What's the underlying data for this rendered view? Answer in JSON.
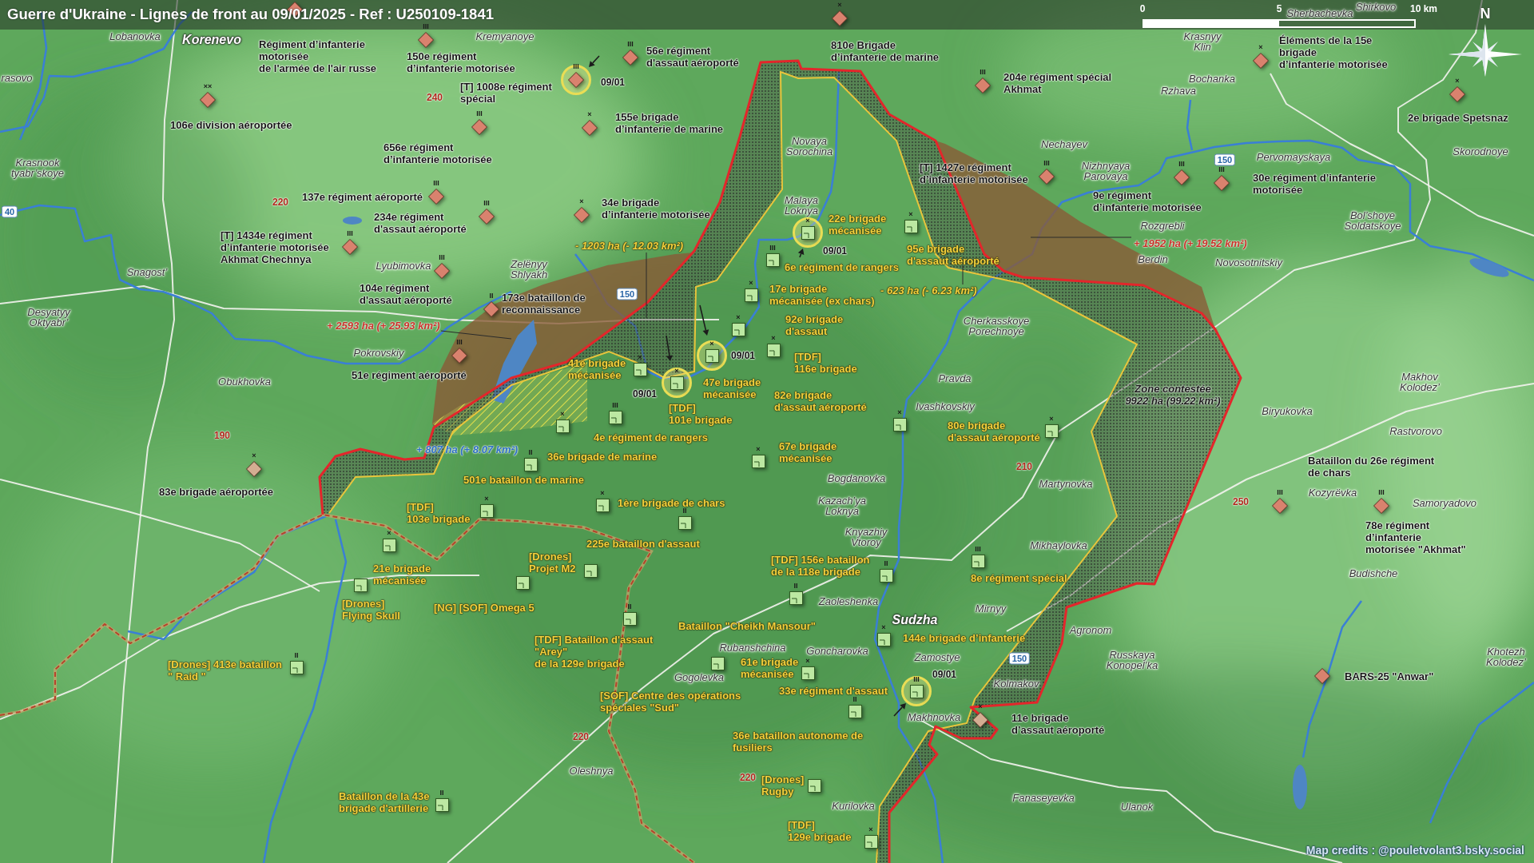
{
  "title": "Guerre d'Ukraine - Lignes de front au 09/01/2025 - Ref : U250109-1841",
  "scale_bar": {
    "labels": [
      "0",
      "5",
      "10 km"
    ]
  },
  "compass": {
    "label": "N"
  },
  "units": [
    {
      "kind": "russian",
      "color": "#d9826e",
      "label": [
        "Régiment d’infanterie",
        "motorisée",
        "de l'armée de l'air russe"
      ]
    },
    {
      "kind": "russian",
      "echelon": "III",
      "color": "#d9826e",
      "label": [
        "150e régiment",
        "d’infanterie motorisée"
      ]
    },
    {
      "kind": "russian",
      "echelon": "III",
      "color": "#d9826e",
      "label": [
        "56e régiment",
        "d'assaut aéroporté"
      ]
    },
    {
      "kind": "russian",
      "echelon": "×",
      "color": "#d9826e",
      "label": [
        "810e Brigade",
        "d’infanterie de marine"
      ]
    },
    {
      "kind": "russian",
      "echelon": "×",
      "color": "#d9826e",
      "label": [
        "Éléments de la 15e",
        "brigade",
        "d’infanterie motorisée"
      ]
    },
    {
      "kind": "russian",
      "echelon": "III",
      "color": "#d9826e",
      "label": [
        "[T] 1008e régiment",
        "spécial"
      ],
      "date": "09/01"
    },
    {
      "kind": "russian",
      "echelon": "III",
      "color": "#d9826e",
      "label": [
        "204e régiment spécial",
        "Akhmat"
      ]
    },
    {
      "kind": "russian",
      "echelon": "××",
      "color": "#d9826e",
      "label": [
        "106e division aéroportée"
      ]
    },
    {
      "kind": "russian",
      "echelon": "×",
      "color": "#d9826e",
      "label": [
        "155e brigade",
        "d’infanterie de marine"
      ]
    },
    {
      "kind": "russian",
      "echelon": "×",
      "color": "#d9826e",
      "label": [
        "2e brigade Spetsnaz"
      ]
    },
    {
      "kind": "russian",
      "echelon": "III",
      "color": "#d9826e",
      "label": [
        "656e régiment",
        "d’infanterie motorisée"
      ]
    },
    {
      "kind": "russian",
      "echelon": "III",
      "color": "#d9826e",
      "label": [
        "[T] 1427e régiment",
        "d’infanterie motorisée"
      ]
    },
    {
      "kind": "russian",
      "echelon": "III",
      "color": "#d9826e",
      "label": [
        "137e régiment aéroporté"
      ]
    },
    {
      "kind": "russian",
      "echelon": "III",
      "color": "#d9826e",
      "label": [
        "9e régiment",
        "d’infanterie motorisée"
      ]
    },
    {
      "kind": "russian",
      "echelon": "III",
      "color": "#d9826e",
      "label": [
        "30e régiment d’infanterie",
        "motorisée"
      ]
    },
    {
      "kind": "russian",
      "echelon": "III",
      "color": "#d9826e",
      "label": [
        "234e régiment",
        "d'assaut aéroporté"
      ]
    },
    {
      "kind": "russian",
      "echelon": "×",
      "color": "#d9826e",
      "label": [
        "34e brigade",
        "d’infanterie motorisée"
      ]
    },
    {
      "kind": "russian",
      "echelon": "III",
      "color": "#d9826e",
      "label": [
        "[T] 1434e régiment",
        "d’infanterie motorisée",
        "Akhmat Chechnya"
      ]
    },
    {
      "kind": "ukrainian",
      "echelon": "×",
      "label": [
        "22e brigade",
        "mécanisée"
      ],
      "date": "09/01"
    },
    {
      "kind": "ukrainian",
      "echelon": "III",
      "label": [
        "6e régiment de rangers"
      ]
    },
    {
      "kind": "ukrainian",
      "echelon": "×",
      "label": [
        "95e brigade",
        "d'assaut aéroporté"
      ]
    },
    {
      "kind": "russian",
      "echelon": "III",
      "color": "#d9826e",
      "label": [
        "104e régiment",
        "d'assaut aéroporté"
      ]
    },
    {
      "kind": "russian",
      "echelon": "II",
      "color": "#d9826e",
      "label": [
        "173e bataillon de",
        "reconnaissance"
      ]
    },
    {
      "kind": "ukrainian",
      "echelon": "×",
      "label": [
        "17e brigade",
        "mécanisée (ex chars)"
      ]
    },
    {
      "kind": "ukrainian",
      "echelon": "×",
      "label": [
        "92e brigade",
        "d'assaut"
      ]
    },
    {
      "kind": "russian",
      "echelon": "III",
      "color": "#d9826e",
      "label": [
        "51e régiment aéroporté"
      ]
    },
    {
      "kind": "ukrainian",
      "echelon": "×",
      "label": [
        "41e brigade",
        "mécanisée"
      ]
    },
    {
      "kind": "ukrainian",
      "echelon": "×",
      "label": [
        "47e brigade",
        "mécanisée"
      ],
      "date": "09/01"
    },
    {
      "kind": "ukrainian",
      "echelon": "×",
      "label": [
        "[TDF]",
        "116e brigade"
      ]
    },
    {
      "kind": "ukrainian",
      "echelon": "×",
      "label": [
        "36e brigade de marine"
      ]
    },
    {
      "kind": "ukrainian",
      "echelon": "III",
      "label": [
        "4e régiment de rangers"
      ]
    },
    {
      "kind": "ukrainian",
      "echelon": "×",
      "label": [
        "[TDF]",
        "101e brigade"
      ],
      "date": "09/01"
    },
    {
      "kind": "ukrainian",
      "echelon": "×",
      "label": [
        "82e brigade",
        "d'assaut aéroporté"
      ]
    },
    {
      "kind": "ukrainian",
      "echelon": "×",
      "label": [
        "80e brigade",
        "d'assaut aéroporté"
      ]
    },
    {
      "kind": "russian",
      "echelon": "×",
      "color": "#d4ad92",
      "label": [
        "83e brigade aéroportée"
      ]
    },
    {
      "kind": "ukrainian",
      "echelon": "II",
      "label": [
        "501e bataillon de marine"
      ]
    },
    {
      "kind": "ukrainian",
      "echelon": "×",
      "label": [
        "67e brigade",
        "mécanisée"
      ]
    },
    {
      "kind": "ukrainian",
      "echelon": "×",
      "label": [
        "[TDF]",
        "103e brigade"
      ]
    },
    {
      "kind": "ukrainian",
      "echelon": "×",
      "label": [
        "1ère brigade de chars"
      ]
    },
    {
      "kind": "russian",
      "echelon": "III",
      "color": "#d9826e",
      "label": [
        "Bataillon du 26e régiment",
        "de chars"
      ]
    },
    {
      "kind": "ukrainian",
      "echelon": "II",
      "label": [
        "225e bataillon d'assaut"
      ]
    },
    {
      "kind": "russian",
      "echelon": "III",
      "color": "#d9826e",
      "label": [
        "78e régiment",
        "d’infanterie",
        "motorisée \"Akhmat\""
      ]
    },
    {
      "kind": "ukrainian",
      "echelon": "×",
      "label": [
        "21e brigade",
        "mécanisée"
      ]
    },
    {
      "kind": "ukrainian",
      "label": [
        "[Drones]",
        "Projet M2"
      ]
    },
    {
      "kind": "ukrainian",
      "echelon": "II",
      "label": [
        "[TDF] 156e bataillon",
        "de la 118e brigade"
      ]
    },
    {
      "kind": "ukrainian",
      "echelon": "III",
      "label": [
        "8e régiment spécial"
      ]
    },
    {
      "kind": "ukrainian",
      "label": [
        "[Drones]",
        "Flying Skull"
      ]
    },
    {
      "kind": "ukrainian",
      "label": [
        "[NG] [SOF] Omega 5"
      ]
    },
    {
      "kind": "ukrainian",
      "echelon": "II",
      "label": [
        "[TDF] Bataillon d'assaut",
        "\"Arey\"",
        "de la 129e brigade"
      ]
    },
    {
      "kind": "ukrainian",
      "echelon": "II",
      "label": [
        "Bataillon \"Cheikh Mansour\""
      ]
    },
    {
      "kind": "ukrainian",
      "echelon": "×",
      "label": [
        "144e brigade d’infanterie"
      ]
    },
    {
      "kind": "ukrainian",
      "echelon": "II",
      "label": [
        "[Drones] 413e bataillon",
        "\" Raid \""
      ]
    },
    {
      "kind": "ukrainian",
      "label": [
        "[SOF] Centre des opérations",
        "spéciales \"Sud\""
      ]
    },
    {
      "kind": "ukrainian",
      "echelon": "×",
      "label": [
        "61e brigade",
        "mécanisée"
      ]
    },
    {
      "kind": "ukrainian",
      "echelon": "III",
      "label": [
        "33e régiment d'assaut"
      ],
      "date": "09/01"
    },
    {
      "kind": "russian",
      "color": "#d9826e",
      "label": [
        "BARS-25 \"Anwar\""
      ]
    },
    {
      "kind": "ukrainian",
      "echelon": "II",
      "label": [
        "36e bataillon autonome de",
        "fusiliers"
      ]
    },
    {
      "kind": "russian",
      "echelon": "×",
      "color": "#d4ad92",
      "label": [
        "11e brigade",
        "d’assaut aéroporté"
      ]
    },
    {
      "kind": "ukrainian",
      "label": [
        "[Drones]",
        "Rugby"
      ]
    },
    {
      "kind": "ukrainian",
      "echelon": "II",
      "label": [
        "Bataillon de la 43e",
        "brigade d'artillerie"
      ]
    },
    {
      "kind": "ukrainian",
      "echelon": "×",
      "label": [
        "[TDF]",
        "129e brigade"
      ]
    }
  ],
  "places": [
    {
      "kind": "village",
      "lines": [
        "Sherbachevka"
      ]
    },
    {
      "kind": "village",
      "lines": [
        "Shirkovo"
      ]
    },
    {
      "kind": "village",
      "lines": [
        "Lobanovka"
      ]
    },
    {
      "kind": "town",
      "lines": [
        "Korenevo"
      ]
    },
    {
      "kind": "village",
      "lines": [
        "Kremyanoye"
      ]
    },
    {
      "kind": "village",
      "lines": [
        "Krasnyy",
        "Klin"
      ]
    },
    {
      "kind": "village",
      "lines": [
        "rasovo"
      ]
    },
    {
      "kind": "village",
      "lines": [
        "Bochanka"
      ]
    },
    {
      "kind": "village",
      "lines": [
        "Rzhava"
      ]
    },
    {
      "kind": "village",
      "lines": [
        "Novaya",
        "Sorochina"
      ]
    },
    {
      "kind": "village",
      "lines": [
        "Nechayev"
      ]
    },
    {
      "kind": "village",
      "lines": [
        "Skorodnoye"
      ]
    },
    {
      "kind": "village",
      "lines": [
        "Krasnook",
        "tyabr’skoye"
      ]
    },
    {
      "kind": "village",
      "lines": [
        "Nizhnyaya",
        "Parovaya"
      ]
    },
    {
      "kind": "village",
      "lines": [
        "Pervomayskaya"
      ]
    },
    {
      "kind": "village",
      "lines": [
        "Malaya",
        "Loknya"
      ]
    },
    {
      "kind": "village",
      "lines": [
        "Rozgrebli"
      ]
    },
    {
      "kind": "village",
      "lines": [
        "Bol’shoye",
        "Soldatskoye"
      ]
    },
    {
      "kind": "village",
      "lines": [
        "Snagost’"
      ]
    },
    {
      "kind": "village",
      "lines": [
        "Lyubimovka"
      ]
    },
    {
      "kind": "village",
      "lines": [
        "Zelënyy",
        "Shlyakh"
      ]
    },
    {
      "kind": "village",
      "lines": [
        "Berdin"
      ]
    },
    {
      "kind": "village",
      "lines": [
        "Novosotnitskiy"
      ]
    },
    {
      "kind": "village",
      "lines": [
        "Desyatyy",
        "Oktyabr’"
      ]
    },
    {
      "kind": "village",
      "lines": [
        "Cherkasskoye",
        "Porechnoye"
      ]
    },
    {
      "kind": "village",
      "lines": [
        "Pokrovskiy"
      ]
    },
    {
      "kind": "village",
      "lines": [
        "Obukhovka"
      ]
    },
    {
      "kind": "village",
      "lines": [
        "Pravda"
      ]
    },
    {
      "kind": "village",
      "lines": [
        "Makhov",
        "Kolodez’"
      ]
    },
    {
      "kind": "village",
      "lines": [
        "Ivashkovskiy"
      ]
    },
    {
      "kind": "village",
      "lines": [
        "Biryukovka"
      ]
    },
    {
      "kind": "village",
      "lines": [
        "Rastvorovo"
      ]
    },
    {
      "kind": "village",
      "lines": [
        "Bogdanovka"
      ]
    },
    {
      "kind": "village",
      "lines": [
        "Martynovka"
      ]
    },
    {
      "kind": "village",
      "lines": [
        "Kazach’ya",
        "Loknya"
      ]
    },
    {
      "kind": "village",
      "lines": [
        "Kozyrëvka"
      ]
    },
    {
      "kind": "village",
      "lines": [
        "Samoryadovo"
      ]
    },
    {
      "kind": "village",
      "lines": [
        "Knyazhiy",
        "Vtoroy"
      ]
    },
    {
      "kind": "village",
      "lines": [
        "Mikhaylovka"
      ]
    },
    {
      "kind": "village",
      "lines": [
        "Budishche"
      ]
    },
    {
      "kind": "village",
      "lines": [
        "Zaoleshenka"
      ]
    },
    {
      "kind": "village",
      "lines": [
        "Mirnyy"
      ]
    },
    {
      "kind": "town",
      "lines": [
        "Sudzha"
      ]
    },
    {
      "kind": "village",
      "lines": [
        "Agronom"
      ]
    },
    {
      "kind": "village",
      "lines": [
        "Rubanshchina"
      ]
    },
    {
      "kind": "village",
      "lines": [
        "Goncharovka"
      ]
    },
    {
      "kind": "village",
      "lines": [
        "Zamostye"
      ]
    },
    {
      "kind": "village",
      "lines": [
        "Russkaya",
        "Konopel’ka"
      ]
    },
    {
      "kind": "village",
      "lines": [
        "Khotezh",
        "Kolodez’"
      ]
    },
    {
      "kind": "village",
      "lines": [
        "Gogolevka"
      ]
    },
    {
      "kind": "village",
      "lines": [
        "Kolmakov"
      ]
    },
    {
      "kind": "village",
      "lines": [
        "Makhnovka"
      ]
    },
    {
      "kind": "village",
      "lines": [
        "Oleshnya"
      ]
    },
    {
      "kind": "village",
      "lines": [
        "Kurilovka"
      ]
    },
    {
      "kind": "village",
      "lines": [
        "Fanaseyevka"
      ]
    },
    {
      "kind": "village",
      "lines": [
        "Ulanok"
      ]
    }
  ],
  "map_numbers": [
    {
      "kind": "plain",
      "text": "240"
    },
    {
      "kind": "boxed",
      "text": "150"
    },
    {
      "kind": "boxed",
      "text": "40"
    },
    {
      "kind": "plain",
      "text": "220"
    },
    {
      "kind": "boxed",
      "text": "150"
    },
    {
      "kind": "plain",
      "text": "190"
    },
    {
      "kind": "plain",
      "text": "210"
    },
    {
      "kind": "plain",
      "text": "250"
    },
    {
      "kind": "boxed",
      "text": "150"
    },
    {
      "kind": "plain",
      "text": "220"
    },
    {
      "kind": "plain",
      "text": "220"
    }
  ],
  "area_notes": [
    {
      "kind": "loss",
      "lines": [
        "- 1203 ha (- 12.03 km²)"
      ]
    },
    {
      "kind": "gain",
      "lines": [
        "+ 1952 ha (+ 19.52 km²)"
      ]
    },
    {
      "kind": "loss",
      "lines": [
        "- 623 ha (- 6.23 km²)"
      ]
    },
    {
      "kind": "gain",
      "lines": [
        "+ 2593 ha (+ 25.93 km²)"
      ]
    },
    {
      "kind": "zone",
      "lines": [
        "Zone contestée",
        "9922 ha (99.22 km²)"
      ]
    },
    {
      "kind": "regain",
      "lines": [
        "+ 807 ha (+ 8.07 km²)"
      ]
    }
  ],
  "credits": "Map credits : @pouletvolant3.bsky.social"
}
